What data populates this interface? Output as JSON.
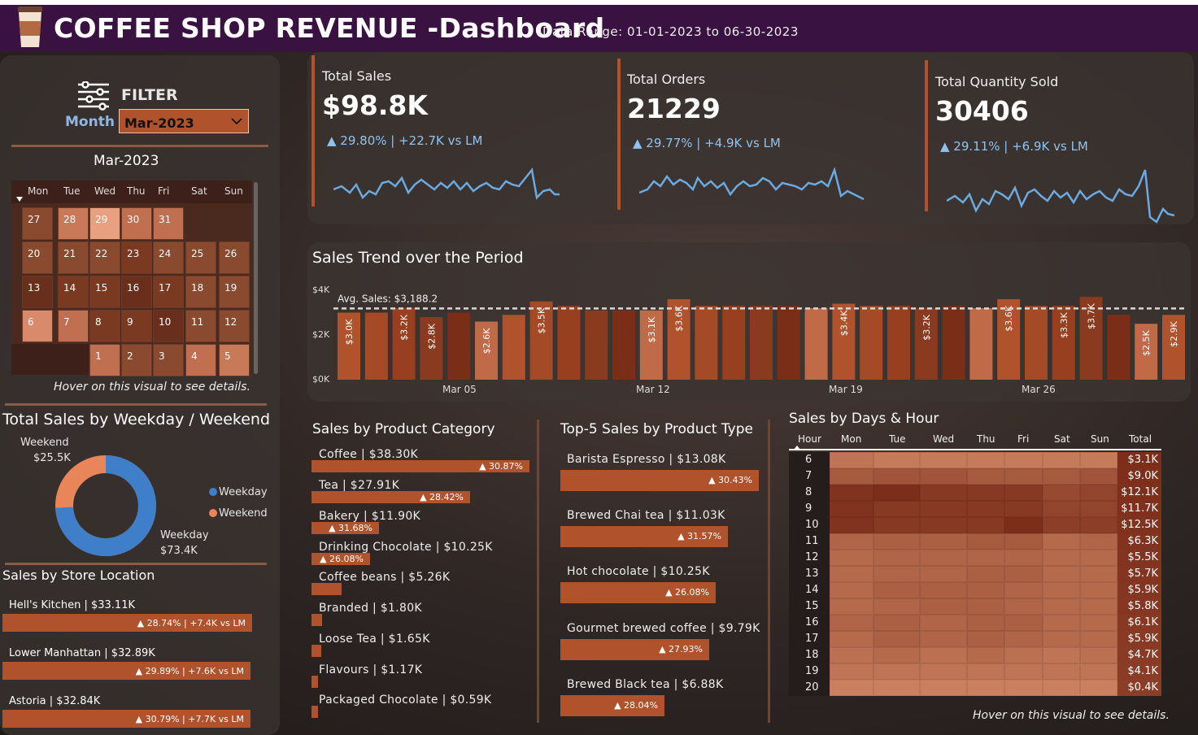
{
  "header": {
    "title": "COFFEE SHOP REVENUE -Dashboard",
    "date_range": "Data Range: 01-01-2023 to 06-30-2023"
  },
  "filter": {
    "label": "FILTER",
    "month_label": "Month",
    "month_value": "Mar-2023"
  },
  "calendar": {
    "title": "Mar-2023",
    "day_names": [
      "Mon",
      "Tue",
      "Wed",
      "Thu",
      "Fri",
      "Sat",
      "Sun"
    ],
    "weeks": [
      [
        "27",
        "28",
        "29",
        "30",
        "31",
        "",
        ""
      ],
      [
        "20",
        "21",
        "22",
        "23",
        "24",
        "25",
        "26"
      ],
      [
        "13",
        "14",
        "15",
        "16",
        "17",
        "18",
        "19"
      ],
      [
        "6",
        "7",
        "8",
        "9",
        "10",
        "11",
        "12"
      ],
      [
        "",
        "",
        "1",
        "2",
        "3",
        "4",
        "5"
      ]
    ],
    "hint": "Hover on this visual to see details."
  },
  "weekday": {
    "title": "Total Sales by Weekday / Weekend",
    "weekend_label": "Weekend",
    "weekend_value": "$25.5K",
    "weekday_label": "Weekday",
    "weekday_value": "$73.4K",
    "legend_weekday": "Weekday",
    "legend_weekend": "Weekend",
    "weekday_share": 0.742,
    "colors": {
      "weekday": "#3f7fc9",
      "weekend": "#e8865a"
    }
  },
  "stores": {
    "title": "Sales by Store Location",
    "items": [
      {
        "name": "Hell's Kitchen | $33.11K",
        "delta": "▲ 28.74% | +7.4K vs LM"
      },
      {
        "name": "Lower Manhattan | $32.89K",
        "delta": "▲ 29.89% | +7.6K vs LM"
      },
      {
        "name": "Astoria | $32.84K",
        "delta": "▲ 30.79% | +7.7K vs LM"
      }
    ]
  },
  "kpis": [
    {
      "title": "Total Sales",
      "value": "$98.8K",
      "delta": "▲ 29.80% | +22.7K vs LM"
    },
    {
      "title": "Total Orders",
      "value": "21229",
      "delta": "▲ 29.77% | +4.9K vs LM"
    },
    {
      "title": "Total Quantity Sold",
      "value": "30406",
      "delta": "▲ 29.11% | +6.9K vs LM"
    }
  ],
  "trend": {
    "title": "Sales Trend over the Period",
    "avg_label": "Avg. Sales: $3,188.2",
    "y_ticks": [
      "$4K",
      "$2K",
      "$0K"
    ],
    "x_ticks": [
      "Mar 05",
      "Mar 12",
      "Mar 19",
      "Mar 26"
    ]
  },
  "chart_data": {
    "type": "bar",
    "title": "Sales Trend over the Period",
    "categories": [
      "Mar 01",
      "Mar 02",
      "Mar 03",
      "Mar 04",
      "Mar 05",
      "Mar 06",
      "Mar 07",
      "Mar 08",
      "Mar 09",
      "Mar 10",
      "Mar 11",
      "Mar 12",
      "Mar 13",
      "Mar 14",
      "Mar 15",
      "Mar 16",
      "Mar 17",
      "Mar 18",
      "Mar 19",
      "Mar 20",
      "Mar 21",
      "Mar 22",
      "Mar 23",
      "Mar 24",
      "Mar 25",
      "Mar 26",
      "Mar 27",
      "Mar 28",
      "Mar 29",
      "Mar 30",
      "Mar 31"
    ],
    "values": [
      3.0,
      3.0,
      3.2,
      2.8,
      3.0,
      2.6,
      2.9,
      3.5,
      3.3,
      3.1,
      3.1,
      3.1,
      3.6,
      3.3,
      3.3,
      3.3,
      3.3,
      3.2,
      3.4,
      3.3,
      3.3,
      3.2,
      3.3,
      3.2,
      3.6,
      3.3,
      3.3,
      3.7,
      2.9,
      2.5,
      2.9
    ],
    "data_labels": [
      "$3.0K",
      "",
      "$3.2K",
      "$2.8K",
      "",
      "$2.6K",
      "",
      "$3.5K",
      "",
      "",
      "",
      "$3.1K",
      "$3.6K",
      "",
      "",
      "",
      "",
      "",
      "$3.4K",
      "",
      "",
      "$3.2K",
      "",
      "",
      "$3.6K",
      "",
      "$3.3K",
      "$3.7K",
      "",
      "$2.5K",
      "$2.9K"
    ],
    "avg": 3.1882,
    "ylim": [
      0,
      4
    ],
    "ylabel": "",
    "xlabel": ""
  },
  "categories": {
    "title": "Sales by Product Category",
    "items": [
      {
        "label": "Coffee | $38.30K",
        "delta": "▲ 30.87%",
        "value": 38.3
      },
      {
        "label": "Tea | $27.91K",
        "delta": "▲ 28.42%",
        "value": 27.91
      },
      {
        "label": "Bakery | $11.90K",
        "delta": "▲ 31.68%",
        "value": 11.9
      },
      {
        "label": "Drinking Chocolate | $10.25K",
        "delta": "▲ 26.08%",
        "value": 10.25
      },
      {
        "label": "Coffee beans | $5.26K",
        "delta": "",
        "value": 5.26
      },
      {
        "label": "Branded | $1.80K",
        "delta": "",
        "value": 1.8
      },
      {
        "label": "Loose Tea | $1.65K",
        "delta": "",
        "value": 1.65
      },
      {
        "label": "Flavours | $1.17K",
        "delta": "",
        "value": 1.17
      },
      {
        "label": "Packaged Chocolate | $0.59K",
        "delta": "",
        "value": 0.59
      }
    ]
  },
  "top5": {
    "title": "Top-5 Sales by Product Type",
    "items": [
      {
        "label": "Barista Espresso | $13.08K",
        "delta": "▲ 30.43%",
        "value": 13.08
      },
      {
        "label": "Brewed Chai tea | $11.03K",
        "delta": "▲ 31.57%",
        "value": 11.03
      },
      {
        "label": "Hot chocolate | $10.25K",
        "delta": "▲ 26.08%",
        "value": 10.25
      },
      {
        "label": "Gourmet brewed coffee | $9.79K",
        "delta": "▲ 27.93%",
        "value": 9.79
      },
      {
        "label": "Brewed Black tea | $6.88K",
        "delta": "▲ 28.04%",
        "value": 6.88
      }
    ]
  },
  "heatmap": {
    "title": "Sales by Days & Hour",
    "columns": [
      "Hour",
      "Mon",
      "Tue",
      "Wed",
      "Thu",
      "Fri",
      "Sat",
      "Sun",
      "Total"
    ],
    "hours": [
      "6",
      "7",
      "8",
      "9",
      "10",
      "11",
      "12",
      "13",
      "14",
      "15",
      "16",
      "17",
      "18",
      "19",
      "20"
    ],
    "totals": [
      "$3.1K",
      "$9.0K",
      "$12.1K",
      "$11.7K",
      "$12.5K",
      "$6.3K",
      "$5.5K",
      "$5.7K",
      "$5.9K",
      "$5.8K",
      "$6.1K",
      "$5.9K",
      "$4.7K",
      "$4.1K",
      "$0.4K"
    ],
    "levels": [
      [
        0.3,
        0.25,
        0.25,
        0.25,
        0.25,
        0.25,
        0.25
      ],
      [
        0.55,
        0.6,
        0.6,
        0.55,
        0.55,
        0.55,
        0.6
      ],
      [
        0.9,
        0.95,
        0.85,
        0.85,
        0.85,
        0.7,
        0.75
      ],
      [
        0.9,
        0.85,
        0.85,
        0.85,
        0.85,
        0.75,
        0.75
      ],
      [
        0.9,
        0.85,
        0.85,
        0.85,
        0.95,
        0.8,
        0.8
      ],
      [
        0.45,
        0.5,
        0.5,
        0.55,
        0.55,
        0.4,
        0.45
      ],
      [
        0.4,
        0.45,
        0.45,
        0.45,
        0.45,
        0.4,
        0.4
      ],
      [
        0.4,
        0.45,
        0.45,
        0.5,
        0.5,
        0.4,
        0.4
      ],
      [
        0.4,
        0.5,
        0.5,
        0.5,
        0.45,
        0.4,
        0.4
      ],
      [
        0.4,
        0.45,
        0.5,
        0.5,
        0.45,
        0.4,
        0.4
      ],
      [
        0.45,
        0.5,
        0.45,
        0.5,
        0.5,
        0.4,
        0.4
      ],
      [
        0.4,
        0.5,
        0.45,
        0.5,
        0.45,
        0.4,
        0.4
      ],
      [
        0.35,
        0.4,
        0.35,
        0.4,
        0.35,
        0.3,
        0.35
      ],
      [
        0.3,
        0.3,
        0.3,
        0.3,
        0.3,
        0.3,
        0.3
      ],
      [
        0.2,
        0.2,
        0.2,
        0.2,
        0.2,
        0.2,
        0.2
      ]
    ],
    "hint": "Hover on this visual to see details."
  }
}
